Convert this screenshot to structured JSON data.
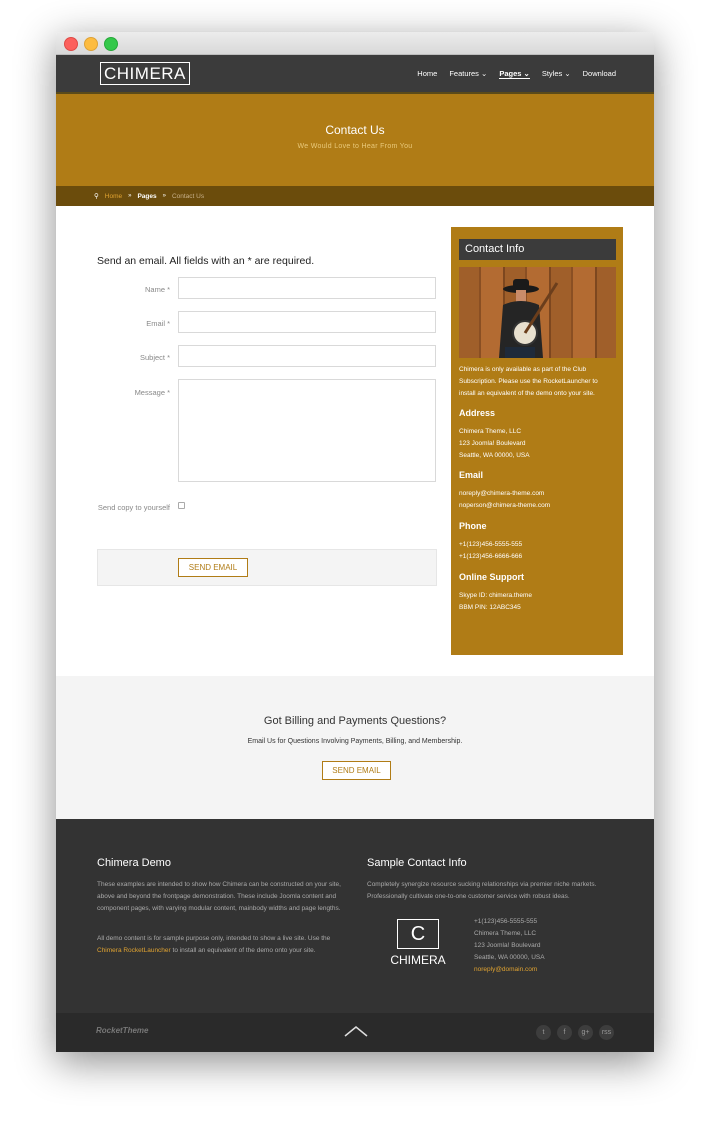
{
  "nav": {
    "logo": "CHIMERA",
    "items": [
      {
        "label": "Home",
        "chevron": ""
      },
      {
        "label": "Features",
        "chevron": "⌄"
      },
      {
        "label": "Pages",
        "chevron": "⌄"
      },
      {
        "label": "Styles",
        "chevron": "⌄"
      },
      {
        "label": "Download",
        "chevron": ""
      }
    ]
  },
  "hero": {
    "title": "Contact Us",
    "subtitle": "We Would Love to Hear From You"
  },
  "breadcrumb": {
    "home": "Home",
    "pages": "Pages",
    "current": "Contact Us"
  },
  "form": {
    "title": "Send an email. All fields with an * are required.",
    "name_label": "Name *",
    "email_label": "Email *",
    "subject_label": "Subject *",
    "message_label": "Message *",
    "copy_label": "Send copy to yourself",
    "submit": "SEND EMAIL"
  },
  "sidebar": {
    "title": "Contact Info",
    "intro": "Chimera is only available as part of the Club Subscription. Please use the RocketLauncher to install an equivalent of the demo onto your site.",
    "address_heading": "Address",
    "address_lines": [
      "Chimera Theme, LLC",
      "123 Joomla! Boulevard",
      "Seattle, WA 00000, USA"
    ],
    "email_heading": "Email",
    "email_lines": [
      "noreply@chimera-theme.com",
      "noperson@chimera-theme.com"
    ],
    "phone_heading": "Phone",
    "phone_lines": [
      "+1(123)456-5555-555",
      "+1(123)456-6666-666"
    ],
    "support_heading": "Online Support",
    "support_lines": [
      "Skype ID: chimera.theme",
      "BBM PIN: 12ABC345"
    ]
  },
  "billing": {
    "title": "Got Billing and Payments Questions?",
    "subtitle": "Email Us for Questions Involving Payments, Billing, and Membership.",
    "button": "SEND EMAIL"
  },
  "footer": {
    "demo_title": "Chimera Demo",
    "demo_p1": "These examples are intended to show how Chimera can be constructed on your site, above and beyond the frontpage demonstration. These include Joomla content and component pages, with varying modular content, mainbody widths and page lengths.",
    "demo_p2_before": "All demo content is for sample purpose only, intended to show a live site. Use the ",
    "demo_p2_link": "Chimera RocketLauncher",
    "demo_p2_after": " to install an equivalent of the demo onto your site.",
    "contact_title": "Sample Contact Info",
    "contact_p": "Completely synergize resource sucking relationships via premier niche markets. Professionally cultivate one-to-one customer service with robust ideas.",
    "logo_letter": "C",
    "logo_name": "CHIMERA",
    "contact_lines": [
      "+1(123)456-5555-555",
      "Chimera Theme, LLC",
      "123 Joomla! Boulevard",
      "Seattle, WA 00000, USA"
    ],
    "contact_email": "noreply@domain.com"
  },
  "bottom": {
    "brand": "RocketTheme",
    "social": [
      "t",
      "f",
      "g+",
      "rss"
    ]
  },
  "colors": {
    "accent": "#b07c16",
    "dark": "#333333"
  }
}
